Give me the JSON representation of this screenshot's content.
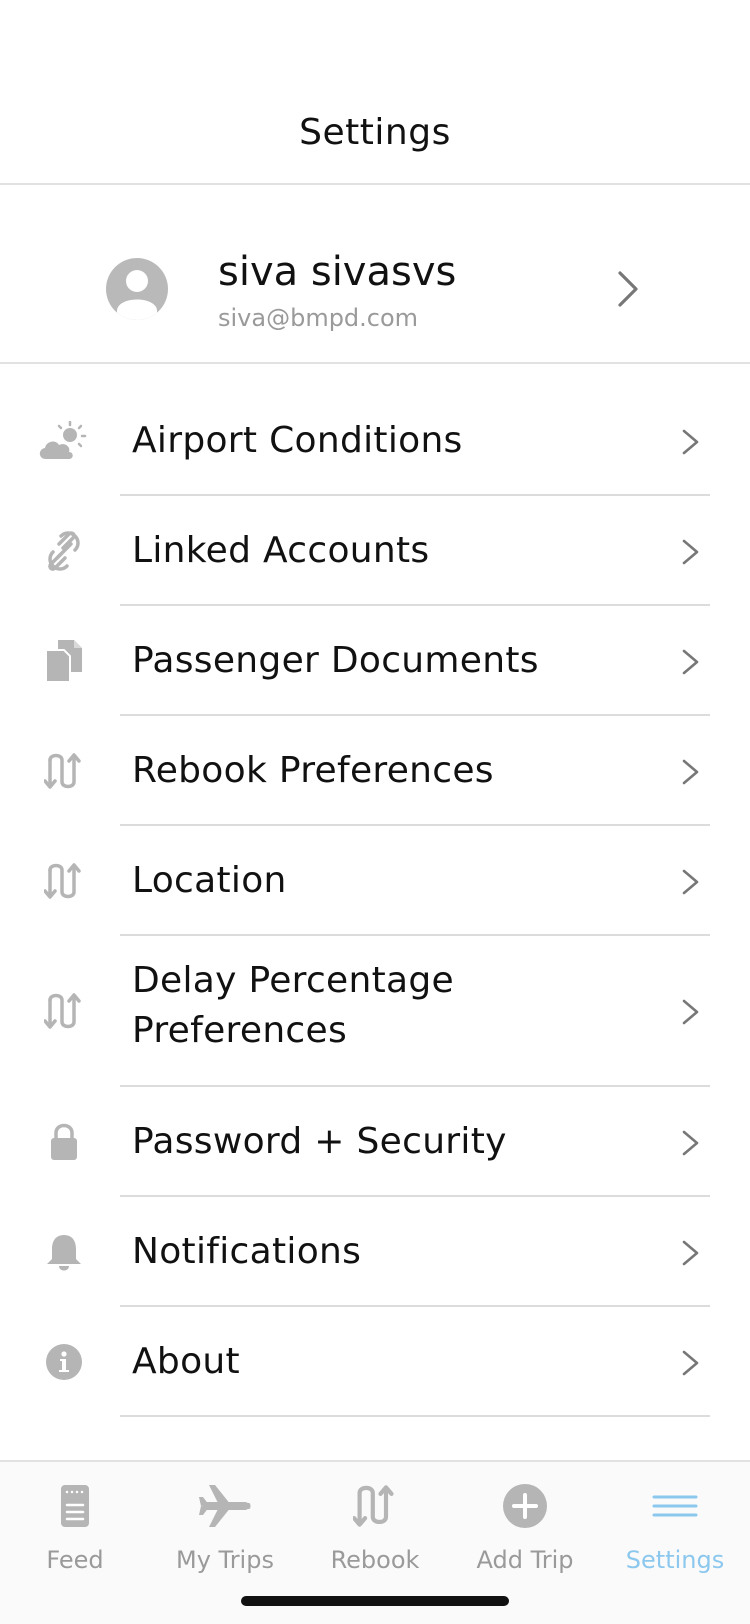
{
  "header": {
    "title": "Settings"
  },
  "profile": {
    "name": "siva sivasvs",
    "email": "siva@bmpd.com"
  },
  "settings": {
    "items": [
      {
        "label": "Airport Conditions",
        "icon": "weather-icon"
      },
      {
        "label": "Linked Accounts",
        "icon": "link-icon"
      },
      {
        "label": "Passenger Documents",
        "icon": "documents-icon"
      },
      {
        "label": "Rebook Preferences",
        "icon": "rebook-icon"
      },
      {
        "label": "Location",
        "icon": "rebook-icon"
      },
      {
        "label": "Delay Percentage Preferences",
        "icon": "rebook-icon"
      },
      {
        "label": "Password + Security",
        "icon": "lock-icon"
      },
      {
        "label": "Notifications",
        "icon": "bell-icon"
      },
      {
        "label": "About",
        "icon": "info-icon"
      }
    ]
  },
  "tabbar": {
    "tabs": [
      {
        "label": "Feed",
        "icon": "feed-icon"
      },
      {
        "label": "My Trips",
        "icon": "airplane-icon"
      },
      {
        "label": "Rebook",
        "icon": "rebook-icon"
      },
      {
        "label": "Add Trip",
        "icon": "plus-circle-icon"
      },
      {
        "label": "Settings",
        "icon": "menu-icon",
        "active": true
      }
    ]
  },
  "colors": {
    "icon_gray": "#b5b5b5",
    "active_tab": "#8cc8ee",
    "divider": "#dcdcdc",
    "text": "#111111",
    "secondary_text": "#9a9a9a"
  }
}
